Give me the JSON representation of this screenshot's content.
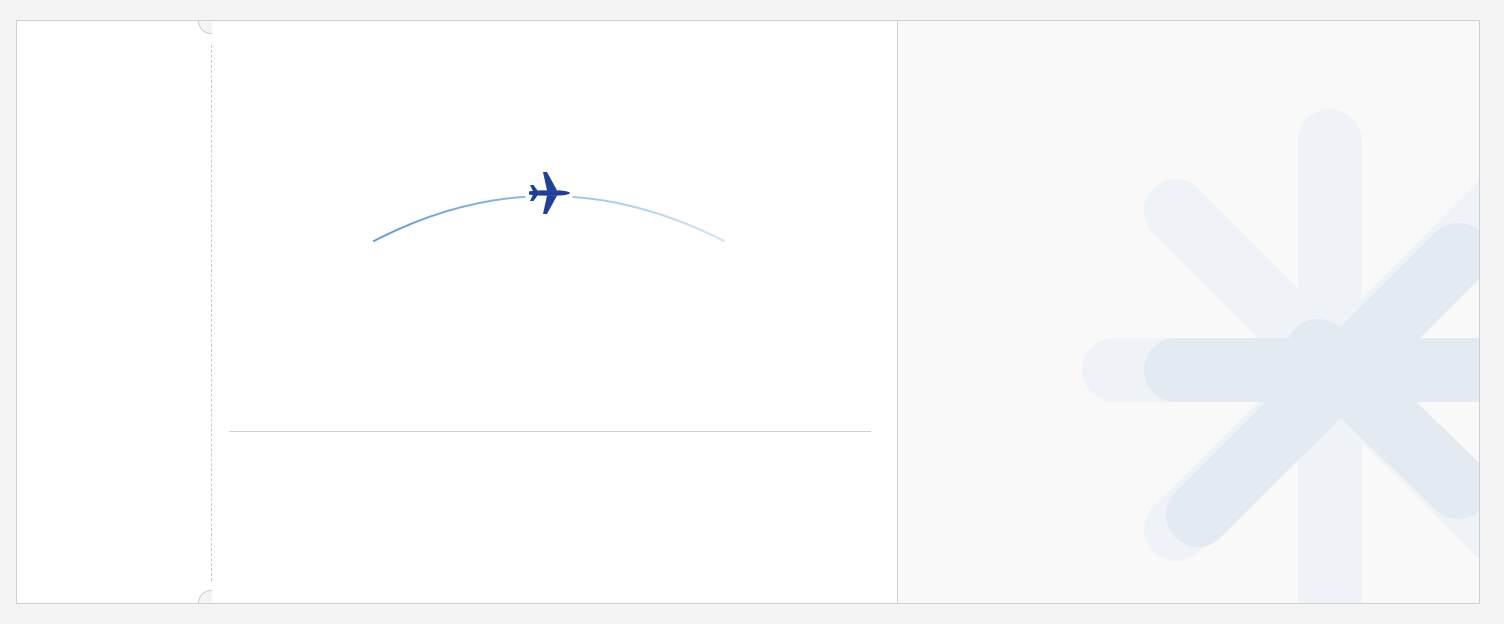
{
  "ticket": {
    "stub": {},
    "route": {
      "plane_icon": "airplane-icon",
      "arc_colors": [
        "#5b9bd5",
        "#c6dcef"
      ]
    },
    "accent_color": "#1f3f99",
    "decoration": {
      "logo_icon": "asterisk-logo-icon",
      "colors": [
        "#e4eaf2",
        "#eff3f7"
      ]
    }
  }
}
